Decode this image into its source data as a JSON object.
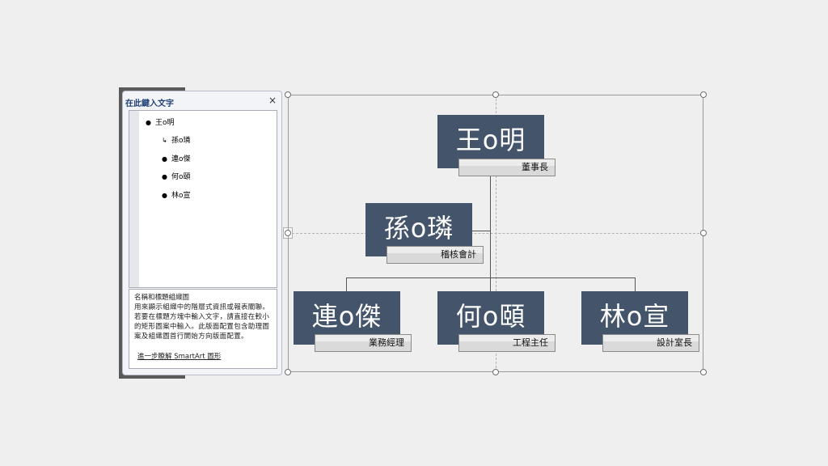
{
  "text_pane": {
    "title": "在此鍵入文字",
    "close_glyph": "×",
    "items": [
      {
        "bullet": "●",
        "text": "王o明"
      },
      {
        "bullet": "↳",
        "text": "孫o璘"
      },
      {
        "bullet": "●",
        "text": "連o傑"
      },
      {
        "bullet": "●",
        "text": "何o頤"
      },
      {
        "bullet": "●",
        "text": "林o宣"
      }
    ],
    "description": {
      "title": "名稱和標題組織圖",
      "body": "用來顯示組織中的階層式資訊或報表關聯。若要在標題方塊中輸入文字，請直接在較小的矩形圖案中輸入。此版面配置包含助理圖案及組織圖首行開始方向版面配置。",
      "link": "進一步瞭解 SmartArt 圖形"
    },
    "toggle_glyph": "›"
  },
  "org_chart": {
    "node_color": "#44546a",
    "nodes": [
      {
        "name": "王o明",
        "role": "董事長"
      },
      {
        "name": "孫o璘",
        "role": "稽核會計"
      },
      {
        "name": "連o傑",
        "role": "業務經理"
      },
      {
        "name": "何o頤",
        "role": "工程主任"
      },
      {
        "name": "林o宣",
        "role": "設計室長"
      }
    ]
  }
}
